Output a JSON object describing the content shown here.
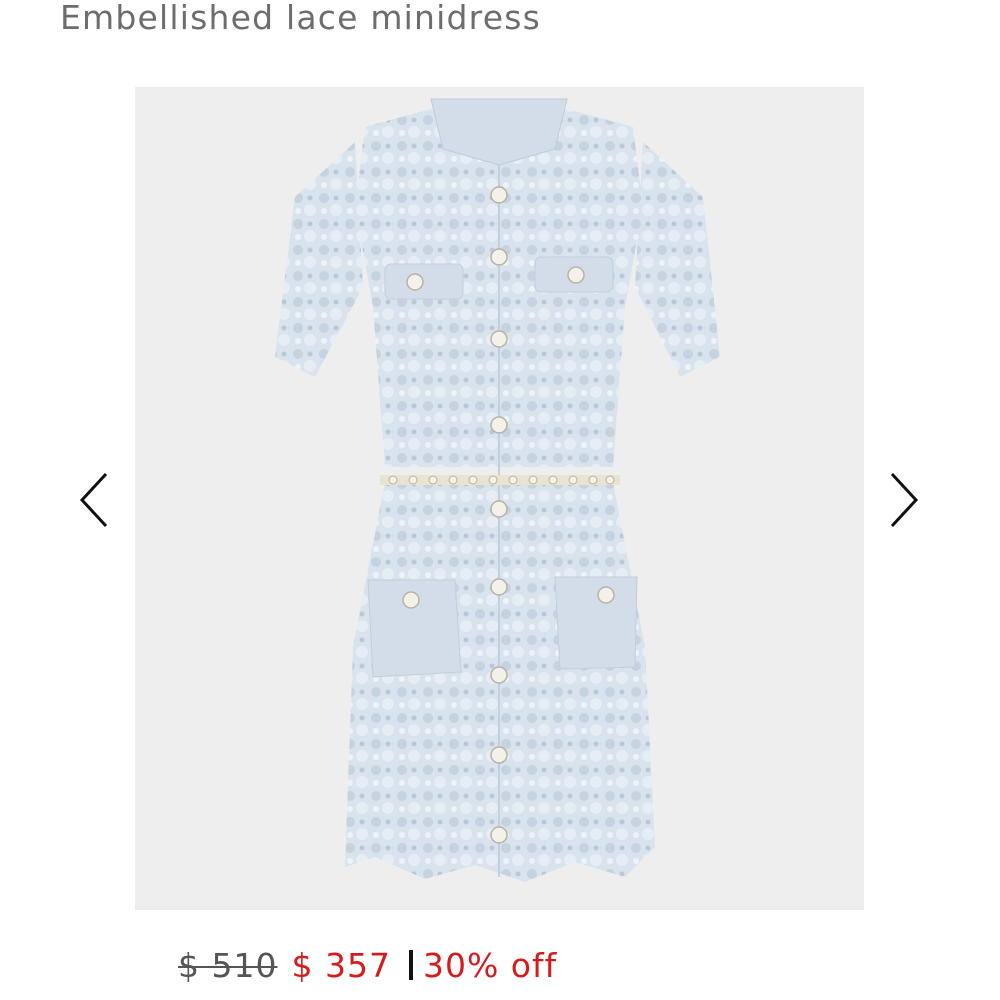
{
  "product": {
    "title": "Embellished lace minidress",
    "image_alt": "Light blue lace minidress with embellished buttons and pearl belt"
  },
  "gallery": {
    "prev_icon": "chevron-left-icon",
    "next_icon": "chevron-right-icon"
  },
  "pricing": {
    "original": "$ 510",
    "sale": "$ 357",
    "discount": "30% off",
    "accent_color": "#d51c1c"
  },
  "colors": {
    "dress": "#d7e1ec",
    "background": "#eeeeee"
  }
}
